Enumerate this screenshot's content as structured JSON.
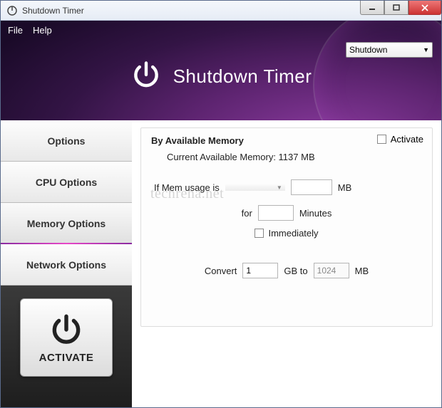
{
  "window": {
    "title": "Shutdown Timer"
  },
  "menu": {
    "file": "File",
    "help": "Help"
  },
  "action_dropdown": {
    "selected": "Shutdown"
  },
  "header": {
    "app_name": "Shutdown Timer"
  },
  "sidebar": {
    "tabs": {
      "options": "Options",
      "cpu": "CPU Options",
      "memory": "Memory Options",
      "network": "Network Options"
    },
    "activate_button": "ACTIVATE"
  },
  "panel": {
    "title": "By Available Memory",
    "activate_label": "Activate",
    "current_mem_label": "Current Available Memory: 1137 MB",
    "if_mem_label": "If Mem usage is",
    "mem_operator": "",
    "mem_value": "",
    "mb_unit": "MB",
    "for_label": "for",
    "for_value": "",
    "minutes_label": "Minutes",
    "immediately_label": "Immediately",
    "convert_label": "Convert",
    "convert_from": "1",
    "gb_to_label": "GB to",
    "convert_to": "1024",
    "mb_unit2": "MB"
  },
  "watermark": "techrena.net"
}
